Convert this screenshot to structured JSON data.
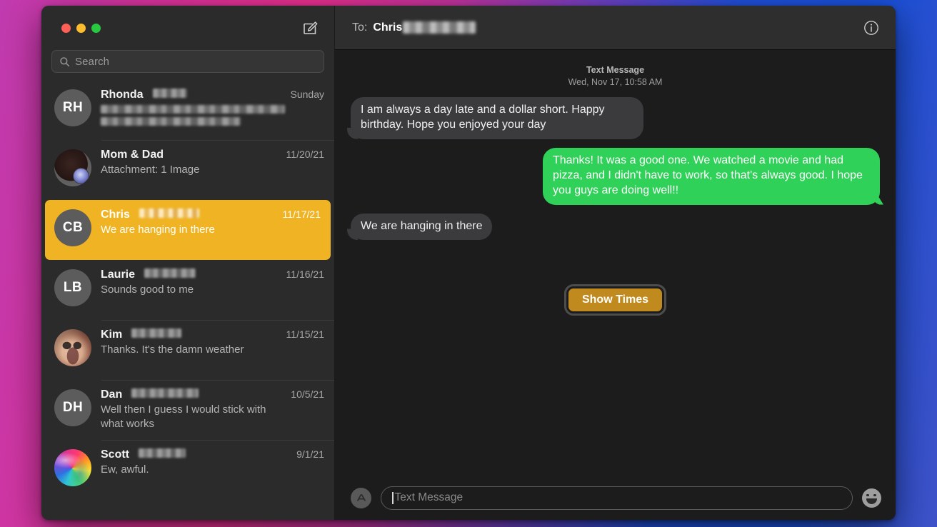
{
  "window": {
    "traffic_lights": {
      "close": "close",
      "minimize": "minimize",
      "zoom": "zoom"
    },
    "compose_icon": "compose-icon"
  },
  "search": {
    "placeholder": "Search",
    "icon": "search-icon"
  },
  "sidebar": {
    "conversations": [
      {
        "name": "Rhonda",
        "name_redacted": true,
        "initials": "RH",
        "avatar_type": "initials",
        "date": "Sunday",
        "preview": "",
        "preview_redacted": true,
        "selected": false
      },
      {
        "name": "Mom & Dad",
        "name_redacted": false,
        "initials": "",
        "avatar_type": "photo-momdad",
        "date": "11/20/21",
        "preview": "Attachment: 1 Image",
        "preview_redacted": false,
        "selected": false
      },
      {
        "name": "Chris",
        "name_redacted": true,
        "initials": "CB",
        "avatar_type": "initials",
        "date": "11/17/21",
        "preview": "We are hanging in there",
        "preview_redacted": false,
        "selected": true
      },
      {
        "name": "Laurie",
        "name_redacted": true,
        "initials": "LB",
        "avatar_type": "initials",
        "date": "11/16/21",
        "preview": "Sounds good to me",
        "preview_redacted": false,
        "selected": false
      },
      {
        "name": "Kim",
        "name_redacted": true,
        "initials": "",
        "avatar_type": "photo-kim",
        "date": "11/15/21",
        "preview": "Thanks.  It's the damn weather",
        "preview_redacted": false,
        "selected": false
      },
      {
        "name": "Dan",
        "name_redacted": true,
        "initials": "DH",
        "avatar_type": "initials",
        "date": "10/5/21",
        "preview": "Well then I guess I would stick with what works",
        "preview_redacted": false,
        "selected": false
      },
      {
        "name": "Scott",
        "name_redacted": true,
        "initials": "",
        "avatar_type": "photo-scott",
        "date": "9/1/21",
        "preview": "Ew, awful.",
        "preview_redacted": false,
        "selected": false
      }
    ]
  },
  "conversation": {
    "to_label": "To:",
    "recipient": "Chris",
    "recipient_redacted": true,
    "info_icon": "info-icon",
    "timestamp": {
      "kind": "Text Message",
      "datetime": "Wed, Nov 17, 10:58 AM"
    },
    "messages": [
      {
        "direction": "in",
        "text": "I am always a day late and a dollar short.   Happy birthday.  Hope you enjoyed your day"
      },
      {
        "direction": "out",
        "text": "Thanks! It was a good one. We watched a movie and had pizza, and I didn't have to work, so that's always good. I hope you guys are doing well!!"
      },
      {
        "direction": "in",
        "text": "We are hanging in there"
      }
    ],
    "show_times_label": "Show Times"
  },
  "composer": {
    "appstore_icon": "app-store-icon",
    "placeholder": "Text Message",
    "value": "",
    "emoji_icon": "smiley-icon"
  },
  "colors": {
    "selected_row": "#f0b323",
    "sent_bubble": "#30d158",
    "received_bubble": "#3b3b3d",
    "show_times_button": "#c08a1e",
    "traffic_red": "#ff5f57",
    "traffic_yellow": "#febc2e",
    "traffic_green": "#28c840"
  }
}
